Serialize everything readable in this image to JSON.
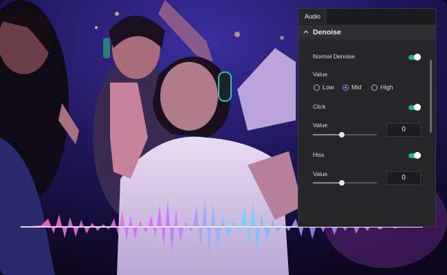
{
  "panel": {
    "tab": "Audio",
    "section": {
      "title": "Denoise",
      "chevron": "chevron-up-icon"
    },
    "normal_denoise": {
      "label": "Normal Denoise",
      "on": true
    },
    "value": {
      "label": "Value",
      "options": [
        "Low",
        "Mid",
        "High"
      ],
      "selected": "Mid"
    },
    "click": {
      "label": "Click",
      "on": true,
      "value_label": "Value",
      "value": "0",
      "slider_level": 0.45
    },
    "hiss": {
      "label": "Hiss",
      "on": true,
      "value_label": "Value",
      "value": "0",
      "slider_level": 0.45
    }
  },
  "colors": {
    "accent_toggle": "#19b39a",
    "accent_radio": "#b48bff",
    "panel_bg": "#262629"
  }
}
